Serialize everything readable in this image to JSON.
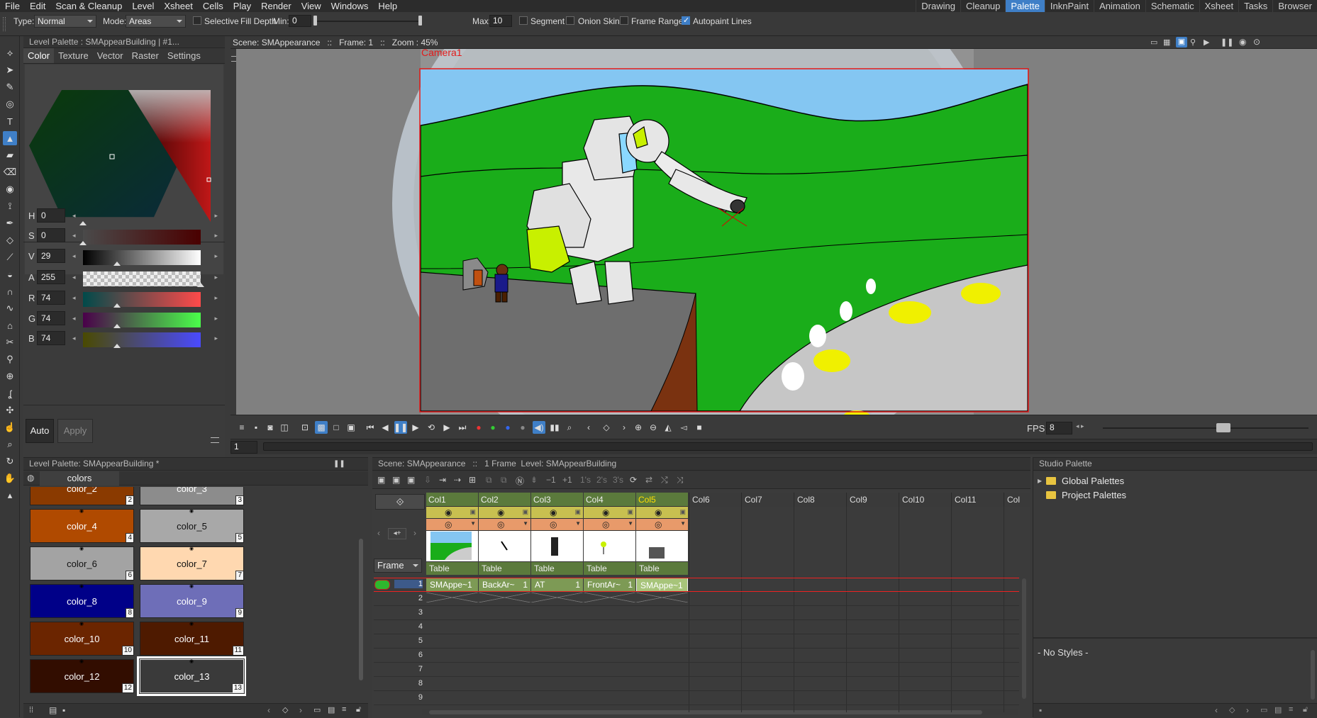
{
  "menu": [
    "File",
    "Edit",
    "Scan & Cleanup",
    "Level",
    "Xsheet",
    "Cells",
    "Play",
    "Render",
    "View",
    "Windows",
    "Help"
  ],
  "rooms": [
    "Drawing",
    "Cleanup",
    "Palette",
    "InknPaint",
    "Animation",
    "Schematic",
    "Xsheet",
    "Tasks",
    "Browser"
  ],
  "active_room": "Palette",
  "tool_options": {
    "type_label": "Type:",
    "type_value": "Normal",
    "mode_label": "Mode:",
    "mode_value": "Areas",
    "selective": "Selective",
    "fill_depth_label": "Fill Depth",
    "min_label": "Min:",
    "min_value": "0",
    "max_label": "Max:",
    "max_value": "10",
    "segment": "Segment",
    "onion_skin": "Onion Skin",
    "frame_range": "Frame Range",
    "autopaint": "Autopaint Lines",
    "autopaint_checked": true
  },
  "style_editor": {
    "title": "Level Palette : SMAppearBuilding | #1...",
    "tabs": [
      "Color",
      "Texture",
      "Vector",
      "Raster",
      "Settings"
    ],
    "active_tab": "Color",
    "channels": [
      {
        "label": "H",
        "value": "0",
        "pos": 0.0
      },
      {
        "label": "S",
        "value": "0",
        "pos": 0.0
      },
      {
        "label": "V",
        "value": "29",
        "pos": 0.29
      },
      {
        "label": "A",
        "value": "255",
        "pos": 1.0
      },
      {
        "label": "R",
        "value": "74",
        "pos": 0.29
      },
      {
        "label": "G",
        "value": "74",
        "pos": 0.29
      },
      {
        "label": "B",
        "value": "74",
        "pos": 0.29
      }
    ],
    "auto_label": "Auto",
    "apply_label": "Apply"
  },
  "viewer": {
    "header": "Scene: SMAppearance   ::   Frame: 1   ::   Zoom : 45%",
    "camera_label": "Camera1"
  },
  "playback": {
    "fps_label": "FPS",
    "fps_value": "8",
    "frame_value": "1"
  },
  "palette": {
    "title": "Level Palette: SMAppearBuilding *",
    "page_tab": "colors",
    "chips": [
      {
        "name": "color_2",
        "num": "2",
        "color": "#8a3a00",
        "text": "#fff"
      },
      {
        "name": "color_3",
        "num": "3",
        "color": "#8c8c8c",
        "text": "#fff"
      },
      {
        "name": "color_4",
        "num": "4",
        "color": "#b04a00",
        "text": "#fff"
      },
      {
        "name": "color_5",
        "num": "5",
        "color": "#a8a8a8",
        "text": "#111"
      },
      {
        "name": "color_6",
        "num": "6",
        "color": "#a3a3a3",
        "text": "#111"
      },
      {
        "name": "color_7",
        "num": "7",
        "color": "#ffd8b0",
        "text": "#111"
      },
      {
        "name": "color_8",
        "num": "8",
        "color": "#000088",
        "text": "#fff"
      },
      {
        "name": "color_9",
        "num": "9",
        "color": "#6e6eb8",
        "text": "#fff"
      },
      {
        "name": "color_10",
        "num": "10",
        "color": "#6b2500",
        "text": "#fff"
      },
      {
        "name": "color_11",
        "num": "11",
        "color": "#4e1a00",
        "text": "#fff"
      },
      {
        "name": "color_12",
        "num": "12",
        "color": "#320d00",
        "text": "#fff"
      },
      {
        "name": "color_13",
        "num": "13",
        "color": "#4a4a4a",
        "text": "#fff"
      }
    ]
  },
  "xsheet": {
    "header": "Scene: SMAppearance   ::   1 Frame  Level: SMAppearBuilding",
    "frame_label": "Frame",
    "columns": [
      {
        "name": "Col1",
        "type": "Table",
        "cell": "SMAppe~1",
        "cell_num": "",
        "active": false
      },
      {
        "name": "Col2",
        "type": "Table",
        "cell": "BackAr~",
        "cell_num": "1",
        "active": false
      },
      {
        "name": "Col3",
        "type": "Table",
        "cell": "AT",
        "cell_num": "1",
        "active": false
      },
      {
        "name": "Col4",
        "type": "Table",
        "cell": "FrontAr~",
        "cell_num": "1",
        "active": false
      },
      {
        "name": "Col5",
        "type": "Table",
        "cell": "SMAppe~1",
        "cell_num": "",
        "active": true
      }
    ],
    "empty_columns": [
      "Col6",
      "Col7",
      "Col8",
      "Col9",
      "Col10",
      "Col11",
      "Col"
    ],
    "rows": [
      "1",
      "2",
      "3",
      "4",
      "5",
      "6",
      "7",
      "8",
      "9"
    ]
  },
  "studio_palette": {
    "title": "Studio Palette",
    "items": [
      "Global Palettes",
      "Project Palettes"
    ],
    "no_styles": "- No Styles -"
  }
}
